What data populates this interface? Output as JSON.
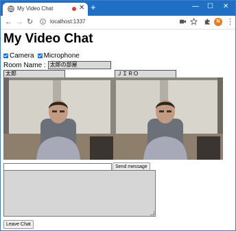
{
  "browser": {
    "tab_title": "My Video Chat",
    "tab_close": "✕",
    "new_tab": "+",
    "address": "localhost:1337",
    "profile_initial": "N",
    "window_minimize": "—",
    "window_maximize": "☐",
    "window_close": "✕",
    "nav_back": "←",
    "nav_forward": "→",
    "nav_reload": "↻",
    "menu": "⋮",
    "accent_color": "#1f6fc5"
  },
  "page": {
    "title": "My Video Chat",
    "camera_label": "Camera",
    "microphone_label": "Microphone",
    "camera_checked": true,
    "microphone_checked": true,
    "room_label": "Room Name :",
    "room_value": "太郎の部屋",
    "local_name": "太郎",
    "remote_name": "ＪＩＲＯ",
    "chat_input_value": "",
    "send_label": "Send message",
    "chat_log": "",
    "leave_label": "Leave Chat"
  }
}
